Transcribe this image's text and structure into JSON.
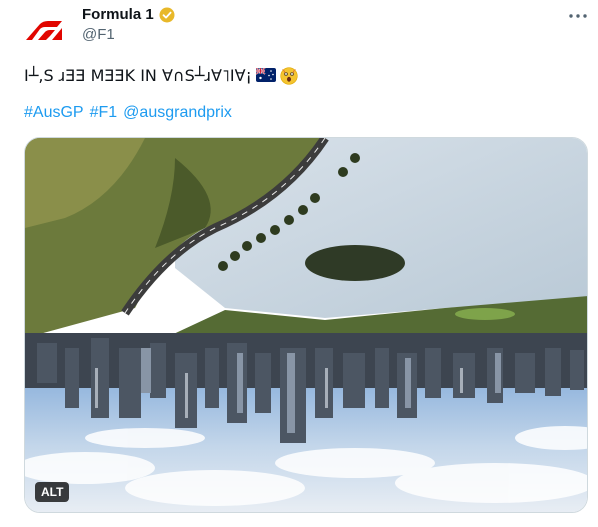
{
  "account": {
    "name": "Formula 1",
    "handle": "@F1",
    "avatar_icon": "f1-logo-icon",
    "verified_icon": "gold-verified-badge-icon",
    "brand_color": "#e10600"
  },
  "tweet": {
    "text": "I┴,S ɹƎƎ MƎƎK IN ∀∩S┴ɹ∀˥I∀¡",
    "emojis": [
      "australia-flag-icon",
      "astonished-face-icon"
    ],
    "hashtags": [
      "#AusGP",
      "#F1",
      "@ausgrandprix"
    ],
    "link_color": "#1d9bf0"
  },
  "media": {
    "alt_label": "ALT",
    "icon": "upside-down-melbourne-skyline-image"
  },
  "menu": {
    "icon": "more-options-icon"
  }
}
